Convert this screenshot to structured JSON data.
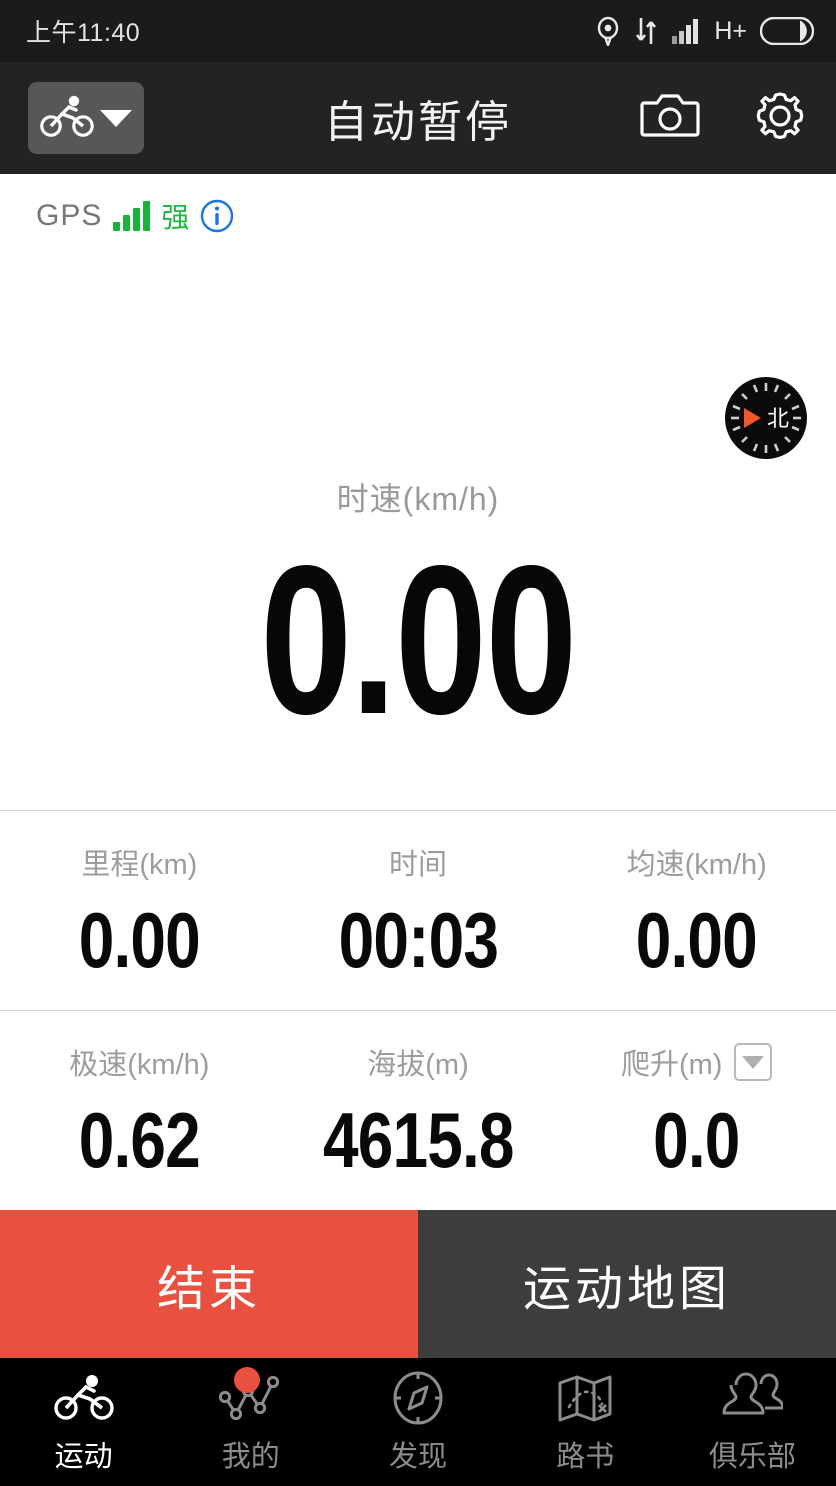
{
  "statusbar": {
    "time": "上午11:40",
    "network": "H+",
    "icons": [
      "location-icon",
      "data-transfer-icon",
      "signal-icon",
      "battery-icon"
    ]
  },
  "header": {
    "title": "自动暂停",
    "activity_icon": "cyclist-icon",
    "dropdown_icon": "caret-down-icon",
    "camera_icon": "camera-icon",
    "settings_icon": "gear-icon"
  },
  "gps": {
    "label": "GPS",
    "strength_text": "强",
    "bars": 4,
    "bar_color": "#19b33c",
    "info_icon": "info-icon",
    "info_color": "#1a73e8"
  },
  "compass": {
    "north_label": "北",
    "needle_color": "#f2562a"
  },
  "speed": {
    "label": "时速(km/h)",
    "value": "0.00"
  },
  "stats_row1": [
    {
      "label": "里程(km)",
      "value": "0.00"
    },
    {
      "label": "时间",
      "value": "00:03"
    },
    {
      "label": "均速(km/h)",
      "value": "0.00"
    }
  ],
  "stats_row2": [
    {
      "label": "极速(km/h)",
      "value": "0.62",
      "dropdown": false
    },
    {
      "label": "海拔(m)",
      "value": "4615.8",
      "dropdown": false
    },
    {
      "label": "爬升(m)",
      "value": "0.0",
      "dropdown": true
    }
  ],
  "actions": {
    "end_label": "结束",
    "end_color": "#e8503f",
    "map_label": "运动地图",
    "map_color": "#3d3d3d"
  },
  "tabbar": [
    {
      "label": "运动",
      "icon": "cyclist-icon",
      "active": true,
      "badge": false
    },
    {
      "label": "我的",
      "icon": "line-chart-icon",
      "active": false,
      "badge": true
    },
    {
      "label": "发现",
      "icon": "compass-icon",
      "active": false,
      "badge": false
    },
    {
      "label": "路书",
      "icon": "folded-map-icon",
      "active": false,
      "badge": false
    },
    {
      "label": "俱乐部",
      "icon": "people-icon",
      "active": false,
      "badge": false
    }
  ]
}
